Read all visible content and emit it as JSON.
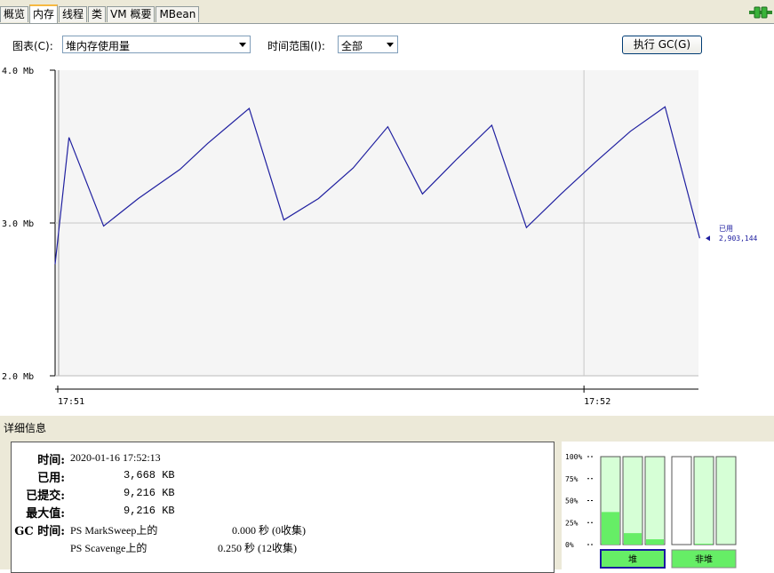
{
  "tabs": [
    {
      "label": "概览",
      "active": false
    },
    {
      "label": "内存",
      "active": true
    },
    {
      "label": "线程",
      "active": false
    },
    {
      "label": "类",
      "active": false
    },
    {
      "label": "VM 概要",
      "active": false
    },
    {
      "label": "MBean",
      "active": false
    }
  ],
  "toolbar": {
    "chart_label": "图表(C):",
    "chart_value": "堆内存使用量",
    "range_label": "时间范围(I):",
    "range_value": "全部",
    "gc_button": "执行 GC(G)"
  },
  "chart_data": {
    "type": "line",
    "y_ticks": [
      "4.0 Mb",
      "3.0 Mb",
      "2.0 Mb"
    ],
    "ylim": [
      2.0,
      4.0
    ],
    "x_ticks": [
      "17:51",
      "17:52"
    ],
    "series": [
      {
        "name": "已用",
        "color": "#2020a0",
        "points": [
          [
            0,
            2.73
          ],
          [
            2,
            3.56
          ],
          [
            7,
            2.98
          ],
          [
            12,
            3.16
          ],
          [
            18,
            3.35
          ],
          [
            22,
            3.52
          ],
          [
            28,
            3.75
          ],
          [
            33,
            3.02
          ],
          [
            38,
            3.16
          ],
          [
            43,
            3.36
          ],
          [
            48,
            3.63
          ],
          [
            53,
            3.19
          ],
          [
            58,
            3.42
          ],
          [
            63,
            3.64
          ],
          [
            68,
            2.97
          ],
          [
            73,
            3.19
          ],
          [
            78,
            3.4
          ],
          [
            83,
            3.6
          ],
          [
            88,
            3.76
          ],
          [
            93,
            2.9
          ]
        ]
      }
    ],
    "current_label": "已用",
    "current_value": "2,903,144"
  },
  "details": {
    "title": "详细信息",
    "time_label": "时间:",
    "time_value": "2020-01-16 17:52:13",
    "used_label": "已用:",
    "used_value": "3,668 KB",
    "committed_label": "已提交:",
    "committed_value": "9,216 KB",
    "max_label": "最大值:",
    "max_value": "9,216 KB",
    "gc_label": "GC 时间:",
    "gc1_name": "PS MarkSweep上的",
    "gc1_value": "0.000 秒 (0收集)",
    "gc2_name": "PS Scavenge上的",
    "gc2_value": "0.250 秒 (12收集)"
  },
  "pools": {
    "ticks": [
      "100%",
      "75%",
      "50%",
      "25%",
      "0%"
    ],
    "heap_bars": [
      0.37,
      0.13,
      0.06
    ],
    "nonheap_bars": [
      0.0,
      0.01,
      0.0
    ],
    "heap_label": "堆",
    "nonheap_label": "非堆"
  },
  "colors": {
    "line": "#2020a0",
    "bar_fill": "#66ee66",
    "bar_bg": "#d6ffd6",
    "selected_border": "#1a1aa0"
  }
}
